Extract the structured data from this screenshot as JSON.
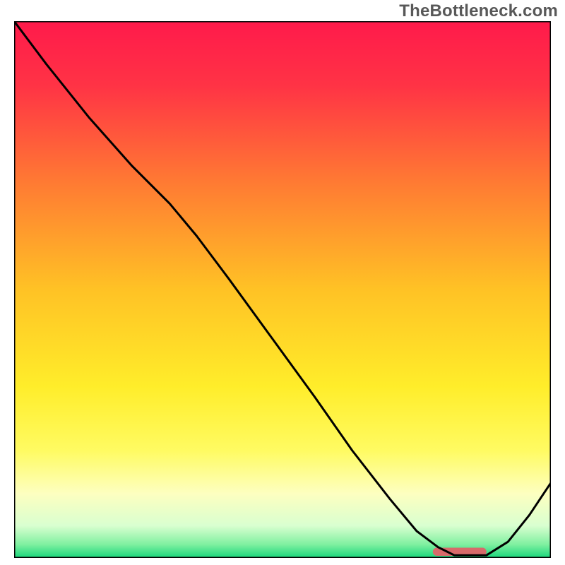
{
  "watermark": "TheBottleneck.com",
  "chart_data": {
    "type": "line",
    "title": "",
    "xlabel": "",
    "ylabel": "",
    "xlim": [
      0,
      100
    ],
    "ylim": [
      0,
      100
    ],
    "grid": false,
    "background_gradient": {
      "stops": [
        {
          "offset": 0.0,
          "color": "#ff1a4b"
        },
        {
          "offset": 0.12,
          "color": "#ff3345"
        },
        {
          "offset": 0.3,
          "color": "#ff7a33"
        },
        {
          "offset": 0.5,
          "color": "#ffc225"
        },
        {
          "offset": 0.68,
          "color": "#ffed2a"
        },
        {
          "offset": 0.8,
          "color": "#fffb62"
        },
        {
          "offset": 0.88,
          "color": "#fdffc0"
        },
        {
          "offset": 0.94,
          "color": "#d9ffd0"
        },
        {
          "offset": 0.975,
          "color": "#7ff0a0"
        },
        {
          "offset": 1.0,
          "color": "#16d67a"
        }
      ]
    },
    "series": [
      {
        "name": "bottleneck-curve",
        "color": "#000000",
        "x": [
          0,
          6,
          14,
          22,
          29,
          34,
          40,
          48,
          56,
          63,
          70,
          75,
          79,
          82,
          85,
          88,
          92,
          96,
          100
        ],
        "y": [
          100,
          92,
          82,
          73,
          66,
          60,
          52,
          41,
          30,
          20,
          11,
          5,
          2,
          0.5,
          0.5,
          0.5,
          3,
          8,
          14
        ]
      }
    ],
    "annotations": [
      {
        "name": "optimal-marker",
        "type": "bar",
        "x_start": 78,
        "x_end": 88,
        "y": 0.4,
        "height": 1.5,
        "color": "#d76a6a"
      }
    ]
  }
}
